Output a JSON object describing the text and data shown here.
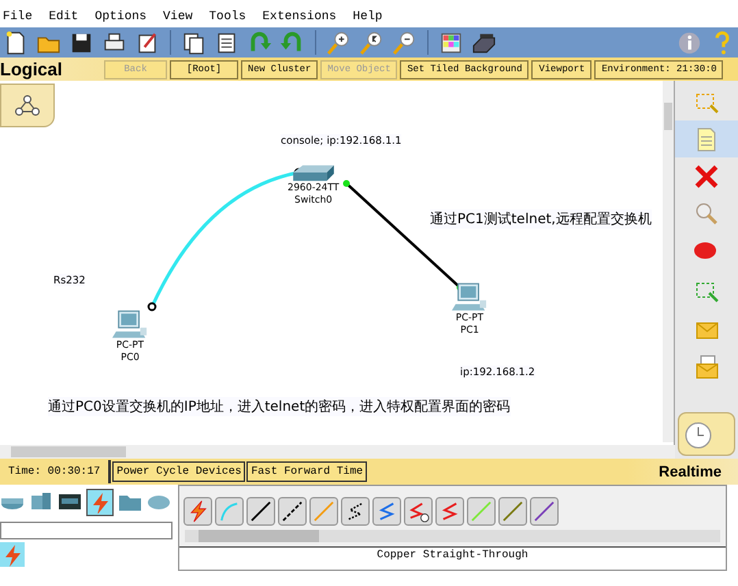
{
  "menu": [
    "File",
    "Edit",
    "Options",
    "View",
    "Tools",
    "Extensions",
    "Help"
  ],
  "nav_buttons": [
    {
      "label": "Back",
      "disabled": true
    },
    {
      "label": "[Root]",
      "disabled": false
    },
    {
      "label": "New Cluster",
      "disabled": false
    },
    {
      "label": "Move Object",
      "disabled": true
    },
    {
      "label": "Set Tiled Background",
      "disabled": false
    },
    {
      "label": "Viewport",
      "disabled": false
    },
    {
      "label": "Environment: 21:30:0",
      "disabled": false
    }
  ],
  "workspace": {
    "label": "Logical"
  },
  "canvas": {
    "devices": [
      {
        "kind": "switch",
        "model": "2960-24TT",
        "name": "Switch0"
      },
      {
        "kind": "pc",
        "model": "PC-PT",
        "name": "PC0"
      },
      {
        "kind": "pc",
        "model": "PC-PT",
        "name": "PC1"
      }
    ],
    "links": [
      {
        "kind": "console",
        "color": "#33e8ef"
      },
      {
        "kind": "copper",
        "color": "#000000"
      }
    ],
    "notes": [
      "console; ip:192.168.1.1",
      "通过PC1测试telnet,远程配置交换机",
      "Rs232",
      "ip:192.168.1.2",
      "通过PC0设置交换机的IP地址，进入telnet的密码，进入特权配置界面的密码"
    ]
  },
  "tools": [
    {
      "kind": "select",
      "selected": false
    },
    {
      "kind": "note",
      "selected": true
    },
    {
      "kind": "delete",
      "selected": false
    },
    {
      "kind": "inspect",
      "selected": false
    },
    {
      "kind": "ellipse",
      "selected": false
    },
    {
      "kind": "resize",
      "selected": false
    },
    {
      "kind": "simple-pdu",
      "selected": false
    },
    {
      "kind": "complex-pdu",
      "selected": false
    }
  ],
  "status_bar": {
    "time": "Time: 00:30:17",
    "buttons": [
      "Power Cycle Devices",
      "Fast Forward Time"
    ],
    "mode": "Realtime"
  },
  "device_categories": [
    {
      "kind": "router",
      "selected": false
    },
    {
      "kind": "switch",
      "selected": false
    },
    {
      "kind": "hub",
      "selected": false
    },
    {
      "kind": "connections",
      "selected": true
    },
    {
      "kind": "folder",
      "selected": false
    },
    {
      "kind": "cloud",
      "selected": false
    }
  ],
  "subcategories": [
    {
      "kind": "connections",
      "selected": true
    }
  ],
  "cables": [
    {
      "kind": "auto"
    },
    {
      "kind": "console"
    },
    {
      "kind": "straight"
    },
    {
      "kind": "cross"
    },
    {
      "kind": "fiber"
    },
    {
      "kind": "phone"
    },
    {
      "kind": "coaxial"
    },
    {
      "kind": "serial-dce"
    },
    {
      "kind": "serial-dte"
    },
    {
      "kind": "octal"
    },
    {
      "kind": "iot"
    },
    {
      "kind": "usb"
    }
  ],
  "cable_label": "Copper Straight-Through"
}
